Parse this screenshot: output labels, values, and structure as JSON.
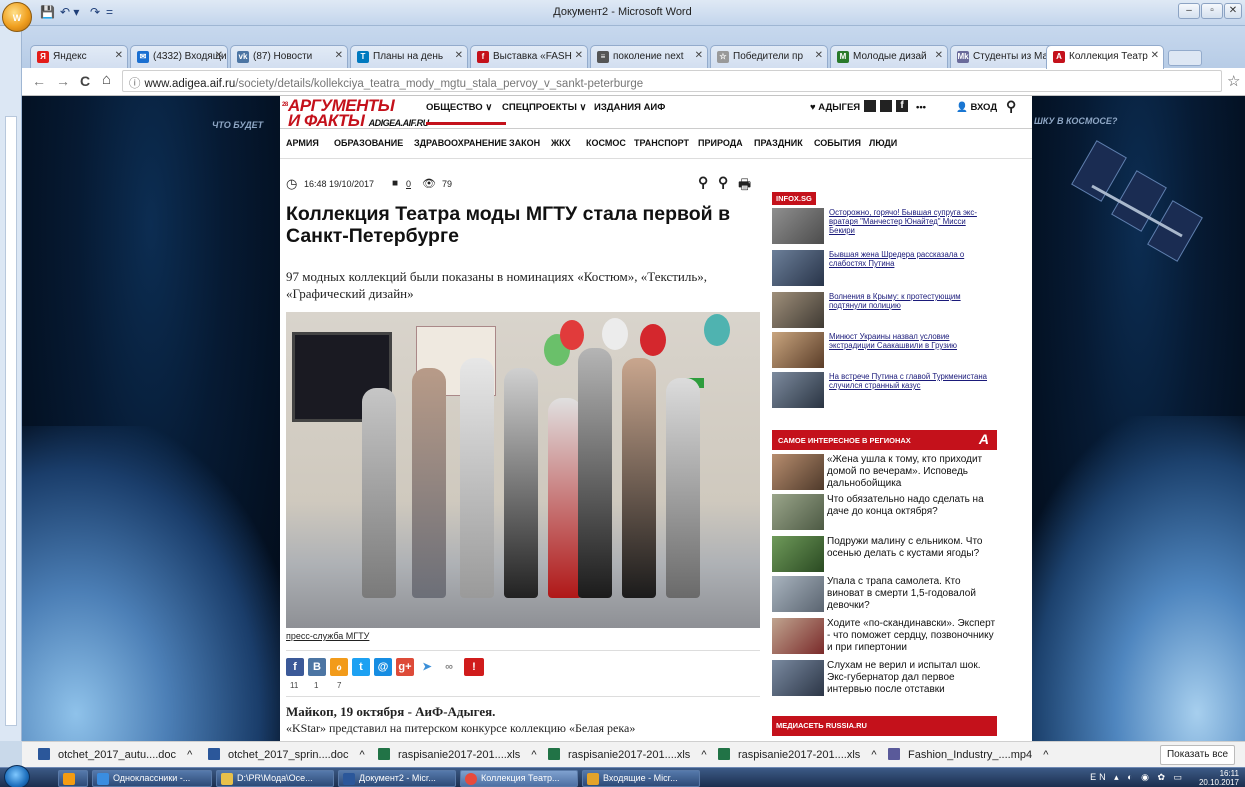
{
  "word": {
    "title": "Документ2 - Microsoft Word",
    "orb_label": "W",
    "qat": [
      "💾",
      "↶ ▾",
      "↷",
      "="
    ],
    "window_buttons": [
      "–",
      "▫",
      "✕"
    ]
  },
  "chrome": {
    "tabs": [
      {
        "label": "Яндекс",
        "fav": "Я",
        "fav_color": "#e31c19"
      },
      {
        "label": "(4332) Входящи",
        "fav": "✉",
        "fav_color": "#1a6fd1"
      },
      {
        "label": "(87) Новости",
        "fav": "vk",
        "fav_color": "#4c75a3"
      },
      {
        "label": "Планы на день",
        "fav": "T",
        "fav_color": "#0079bf"
      },
      {
        "label": "Выставка «FASH",
        "fav": "f",
        "fav_color": "#c4111b"
      },
      {
        "label": "поколение next",
        "fav": "≡",
        "fav_color": "#555"
      },
      {
        "label": "Победители пр",
        "fav": "☆",
        "fav_color": "#999"
      },
      {
        "label": "Молодые дизай",
        "fav": "M",
        "fav_color": "#2a7a2a"
      },
      {
        "label": "Студенты из Ма",
        "fav": "Mk",
        "fav_color": "#6a6a9a"
      },
      {
        "label": "Коллекция Театр",
        "fav": "A",
        "fav_color": "#c4111b"
      }
    ],
    "url_host": "www.adigea.aif.ru",
    "url_path": "/society/details/kollekciya_teatra_mody_mgtu_stala_pervoy_v_sankt-peterburge",
    "nav_icons": [
      "←",
      "→",
      "C",
      "⌂",
      "ⓘ",
      "☆"
    ]
  },
  "site": {
    "logo_line1": "АРГУМЕНТЫ",
    "logo_line2": "И ФАКТЫ",
    "logo_domain": "ADIGEA.AIF.RU",
    "logo_badge": "28",
    "topnav": [
      "ОБЩЕСТВО ∨",
      "СПЕЦПРОЕКТЫ ∨",
      "ИЗДАНИЯ АИФ"
    ],
    "region": "♥ АДЫГЕЯ",
    "more": "•••",
    "login": "👤 ВХОД",
    "subnav": [
      "АРМИЯ",
      "ОБРАЗОВАНИЕ",
      "ЗДРАВООХРАНЕНИЕ",
      "ЗАКОН",
      "ЖКХ",
      "КОСМОС",
      "ТРАНСПОРТ",
      "ПРИРОДА",
      "ПРАЗДНИК",
      "СОБЫТИЯ",
      "ЛЮДИ"
    ],
    "bg_text_left": "ЧТО БУДЕТ",
    "bg_text_right": "ШКУ В КОСМОСЕ?"
  },
  "article": {
    "time": "16:48 19/10/2017",
    "comments": "0",
    "views": "79",
    "headline": "Коллекция Театра моды МГТУ стала первой в Санкт-Петербурге",
    "lead": "97 модных коллекций были показаны в номинациях «Костюм», «Текстиль», «Графический дизайн»",
    "photo_credit": "пресс-служба МГТУ",
    "share_counts": [
      "11",
      "1",
      "7"
    ],
    "dateline": "Майкоп, 19 октября - АиФ-Адыгея.",
    "line2": "«KStar» представил на питерском конкурсе коллекцию «Белая река»"
  },
  "sidebar": {
    "infox_label": "INFOX.SG",
    "infox_items": [
      "Осторожно, горячо! Бывшая супруга экс-вратаря \"Манчестер Юнайтед\" Мисси Бекири",
      "Бывшая жена Шредера рассказала о слабостях Путина",
      "Волнения в Крыму: к протестующим подтянули полицию",
      "Минюст Украины назвал условие экстрадиции Саакашвили в Грузию",
      "На встрече Путина с главой Туркменистана случился странный казус"
    ],
    "regions_title": "САМОЕ ИНТЕРЕСНОЕ В РЕГИОНАХ",
    "region_items": [
      "«Жена ушла к тому, кто приходит домой по вечерам». Исповедь дальнобойщика",
      "Что обязательно надо сделать на даче до конца октября?",
      "Подружи малину с ельником. Что осенью делать с кустами ягоды?",
      "Упала с трапа самолета. Кто виноват в смерти 1,5-годовалой девочки?",
      "Ходите «по-скандинавски». Эксперт - что поможет сердцу, позвоночнику и при гипертонии",
      "Слухам не верил и испытал шок. Экс-губернатор дал первое интервью после отставки"
    ],
    "mediaset_label": "МЕДИАСЕТЬ RUSSIA.RU"
  },
  "downloads": {
    "items": [
      "otchet_2017_autu....doc",
      "otchet_2017_sprin....doc",
      "raspisanie2017-201....xls",
      "raspisanie2017-201....xls",
      "raspisanie2017-201....xls",
      "Fashion_Industry_....mp4"
    ],
    "show_all": "Показать все"
  },
  "taskbar": {
    "items": [
      "",
      "Одноклассники -...",
      "D:\\PR\\Мода\\Осе...",
      "Документ2 - Micr...",
      "Коллекция Театр...",
      "Входящие - Micr..."
    ],
    "lang": "EN",
    "time": "16:11",
    "date": "20.10.2017"
  }
}
